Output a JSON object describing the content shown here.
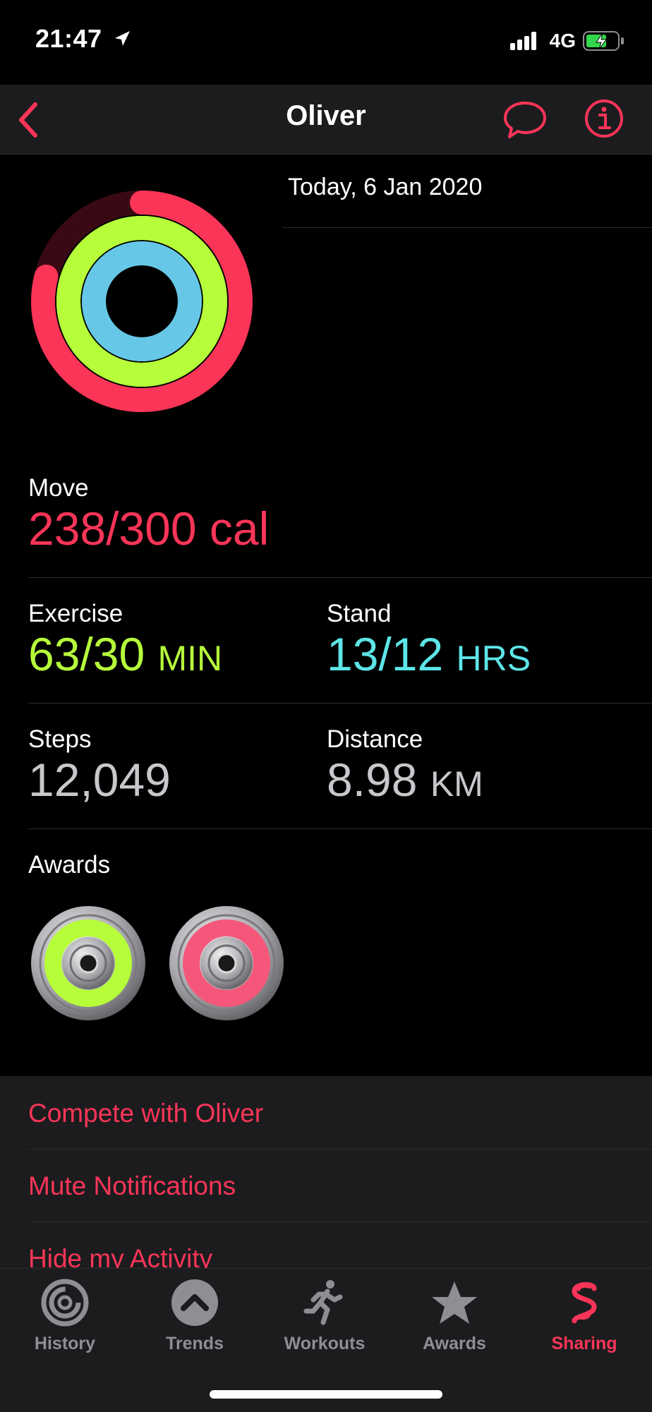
{
  "status": {
    "time": "21:47",
    "network": "4G"
  },
  "nav": {
    "title": "Oliver"
  },
  "date": "Today, 6 Jan 2020",
  "rings": {
    "move_fraction": 0.79,
    "exercise_fraction": 2.1,
    "stand_fraction": 1.08,
    "move_color": "#fa3558",
    "exercise_color": "#b6fd3a",
    "stand_color": "#5de5e8"
  },
  "move": {
    "label": "Move",
    "value": "238/300 cal",
    "color": "#fa3558"
  },
  "exercise": {
    "label": "Exercise",
    "value": "63/30",
    "unit": "MIN",
    "color": "#b6fd3a"
  },
  "stand": {
    "label": "Stand",
    "value": "13/12",
    "unit": "HRS",
    "color": "#5de5e8"
  },
  "steps": {
    "label": "Steps",
    "value": "12,049"
  },
  "distance": {
    "label": "Distance",
    "value": "8.98",
    "unit": "KM"
  },
  "awards": {
    "label": "Awards"
  },
  "actions": [
    {
      "label": "Compete with Oliver"
    },
    {
      "label": "Mute Notifications"
    },
    {
      "label": "Hide my Activity"
    }
  ],
  "tabs": [
    {
      "label": "History"
    },
    {
      "label": "Trends"
    },
    {
      "label": "Workouts"
    },
    {
      "label": "Awards"
    },
    {
      "label": "Sharing",
      "active": true
    }
  ],
  "accent": "#fa3558"
}
